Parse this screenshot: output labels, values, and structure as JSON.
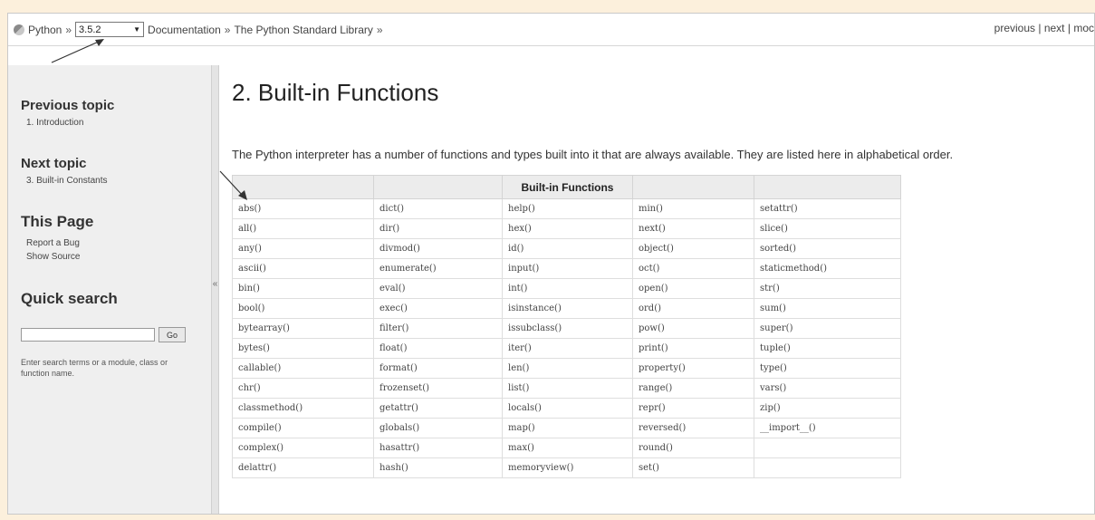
{
  "breadcrumb": {
    "root": "Python",
    "sep": "»",
    "version": "3.5.2",
    "trail": [
      "Documentation",
      "The Python Standard Library"
    ]
  },
  "nav": {
    "previous": "previous",
    "next": "next",
    "mod": "moc",
    "divider": "|"
  },
  "sidebar": {
    "previous_topic_heading": "Previous topic",
    "previous_topic_link": "1. Introduction",
    "next_topic_heading": "Next topic",
    "next_topic_link": "3. Built-in Constants",
    "this_page_heading": "This Page",
    "report_bug": "Report a Bug",
    "show_source": "Show Source",
    "quick_search_heading": "Quick search",
    "search_value": "",
    "go_label": "Go",
    "search_help": "Enter search terms or a module, class or function name.",
    "collapse_glyph": "«"
  },
  "main": {
    "title": "2. Built-in Functions",
    "intro": "The Python interpreter has a number of functions and types built into it that are always available. They are listed here in alphabetical order."
  },
  "table": {
    "header": "Built-in Functions",
    "rows": [
      [
        "abs()",
        "dict()",
        "help()",
        "min()",
        "setattr()"
      ],
      [
        "all()",
        "dir()",
        "hex()",
        "next()",
        "slice()"
      ],
      [
        "any()",
        "divmod()",
        "id()",
        "object()",
        "sorted()"
      ],
      [
        "ascii()",
        "enumerate()",
        "input()",
        "oct()",
        "staticmethod()"
      ],
      [
        "bin()",
        "eval()",
        "int()",
        "open()",
        "str()"
      ],
      [
        "bool()",
        "exec()",
        "isinstance()",
        "ord()",
        "sum()"
      ],
      [
        "bytearray()",
        "filter()",
        "issubclass()",
        "pow()",
        "super()"
      ],
      [
        "bytes()",
        "float()",
        "iter()",
        "print()",
        "tuple()"
      ],
      [
        "callable()",
        "format()",
        "len()",
        "property()",
        "type()"
      ],
      [
        "chr()",
        "frozenset()",
        "list()",
        "range()",
        "vars()"
      ],
      [
        "classmethod()",
        "getattr()",
        "locals()",
        "repr()",
        "zip()"
      ],
      [
        "compile()",
        "globals()",
        "map()",
        "reversed()",
        "__import__()"
      ],
      [
        "complex()",
        "hasattr()",
        "max()",
        "round()",
        ""
      ],
      [
        "delattr()",
        "hash()",
        "memoryview()",
        "set()",
        ""
      ]
    ]
  },
  "colors": {
    "page_bg": "#fcf0dc",
    "sidebar_bg": "#efefef",
    "table_header_bg": "#ececec"
  }
}
